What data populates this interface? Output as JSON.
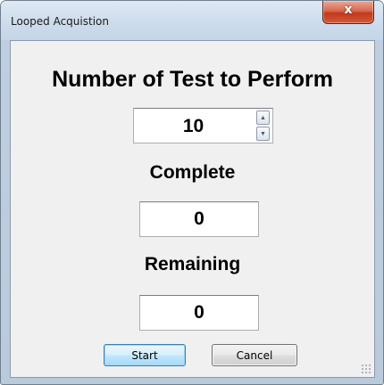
{
  "window": {
    "title": "Looped Acquistion",
    "close_glyph": "x"
  },
  "main": {
    "number_label": "Number of Test to Perform",
    "number_value": "10",
    "complete_label": "Complete",
    "complete_value": "0",
    "remaining_label": "Remaining",
    "remaining_value": "0"
  },
  "buttons": {
    "start": "Start",
    "cancel": "Cancel"
  },
  "icons": {
    "close": "close-icon",
    "spin_up": "chevron-up-icon",
    "spin_down": "chevron-down-icon",
    "grip": "resize-grip-icon"
  }
}
